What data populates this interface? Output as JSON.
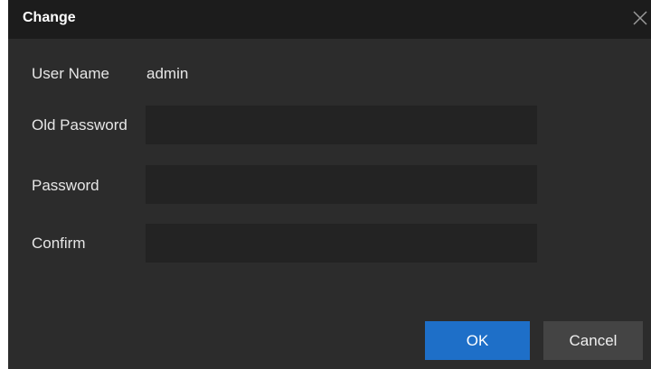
{
  "dialog": {
    "title": "Change",
    "close_icon": "close-icon"
  },
  "form": {
    "user_name_label": "User Name",
    "user_name_value": "admin",
    "old_password_label": "Old Password",
    "old_password_value": "",
    "password_label": "Password",
    "password_value": "",
    "confirm_label": "Confirm",
    "confirm_value": ""
  },
  "buttons": {
    "ok_label": "OK",
    "cancel_label": "Cancel"
  },
  "colors": {
    "dialog_bg": "#2c2c2c",
    "titlebar_bg": "#1c1c1c",
    "field_bg": "#232323",
    "primary": "#1e6fc8",
    "secondary": "#444444"
  }
}
